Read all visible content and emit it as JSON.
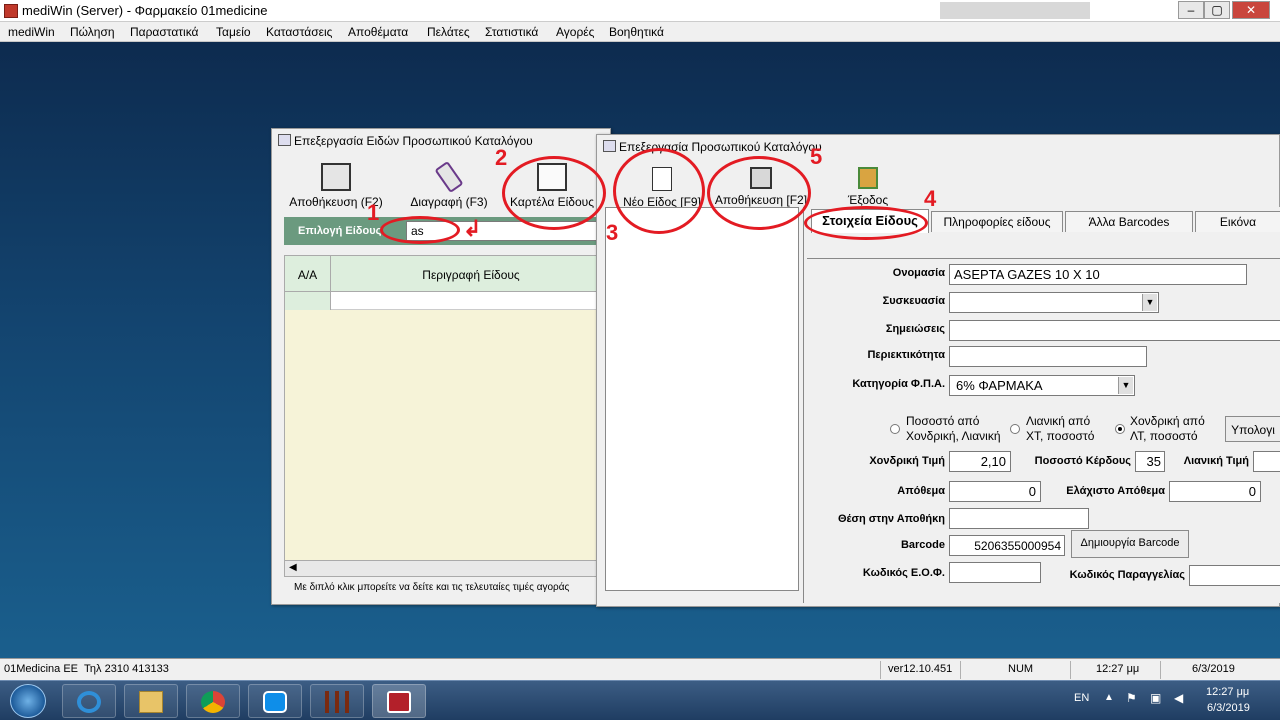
{
  "main_window": {
    "title": "mediWin (Server) - Φαρμακείο 01medicine",
    "controls": [
      "–",
      "▢",
      "✕"
    ]
  },
  "menu": [
    "mediWin",
    "Πώληση",
    "Παραστατικά",
    "Ταμείο",
    "Καταστάσεις",
    "Αποθέματα",
    "Πελάτες",
    "Στατιστικά",
    "Αγορές",
    "Βοηθητικά"
  ],
  "left_window": {
    "title": "Επεξεργασία Ειδών Προσωπικού Καταλόγου",
    "toolbar": {
      "save": "Αποθήκευση (F2)",
      "delete": "Διαγραφή (F3)",
      "card": "Καρτέλα Είδους"
    },
    "search_label": "Επιλογή Είδους",
    "search_value": "as",
    "table_headers": [
      "Α/Α",
      "Περιγραφή Είδους"
    ],
    "footer_hint": "Με διπλό κλικ μπορείτε να δείτε και τις τελευταίες τιμές αγοράς"
  },
  "right_window": {
    "title": "Επεξεργασία Προσωπικού Καταλόγου",
    "toolbar": {
      "new": "Νέο Είδος [F9]",
      "save": "Αποθήκευση [F2]",
      "exit": "Έξοδος"
    },
    "tabs": [
      "Στοιχεία Είδους",
      "Πληροφορίες είδους",
      "Άλλα Barcodes",
      "Εικόνα"
    ],
    "form": {
      "name_label": "Ονομασία",
      "name_value": "ASEPTA GAZES 10 X 10",
      "package_label": "Συσκευασία",
      "package_value": "",
      "notes_label": "Σημειώσεις",
      "notes_value": "",
      "content_label": "Περιεκτικότητα",
      "content_value": "",
      "vat_label": "Κατηγορία Φ.Π.Α.",
      "vat_value": "6% ΦΑΡΜΑΚΑ",
      "radio1": "Ποσοστό από Χονδρική, Λιανική",
      "radio2": "Λιανική από ΧΤ, ποσοστό",
      "radio3": "Χονδρική από ΛΤ, ποσοστό",
      "calc_button": "Υπολογι",
      "wholesale_label": "Χονδρική Τιμή",
      "wholesale_value": "2,10",
      "profit_label": "Ποσοστό Κέρδους",
      "profit_value": "35",
      "retail_label": "Λιανική Τιμή",
      "retail_value": "",
      "stock_label": "Απόθεμα",
      "stock_value": "0",
      "minstock_label": "Ελάχιστο Απόθεμα",
      "minstock_value": "0",
      "location_label": "Θέση στην Αποθήκη",
      "location_value": "",
      "barcode_label": "Barcode",
      "barcode_value": "5206355000954",
      "barcode_button": "Δημιουργία Barcode",
      "eof_label": "Κωδικός Ε.Ο.Φ.",
      "eof_value": "",
      "order_label": "Κωδικός Παραγγελίας",
      "order_value": ""
    }
  },
  "annotations": [
    "1",
    "2",
    "3",
    "4",
    "5"
  ],
  "statusbar": {
    "company": "01Medicina ΕΕ",
    "phone": "Τηλ 2310 413133",
    "version": "ver12.10.451",
    "num": "NUM",
    "time": "12:27 μμ",
    "date": "6/3/2019"
  },
  "taskbar": {
    "lang": "EN",
    "time": "12:27 μμ",
    "date": "6/3/2019",
    "apps": [
      "start-orb-icon",
      "internet-explorer-icon",
      "file-explorer-icon",
      "chrome-icon",
      "teamviewer-icon",
      "mediwin-tool-icon",
      "mediwin-app-icon"
    ]
  }
}
